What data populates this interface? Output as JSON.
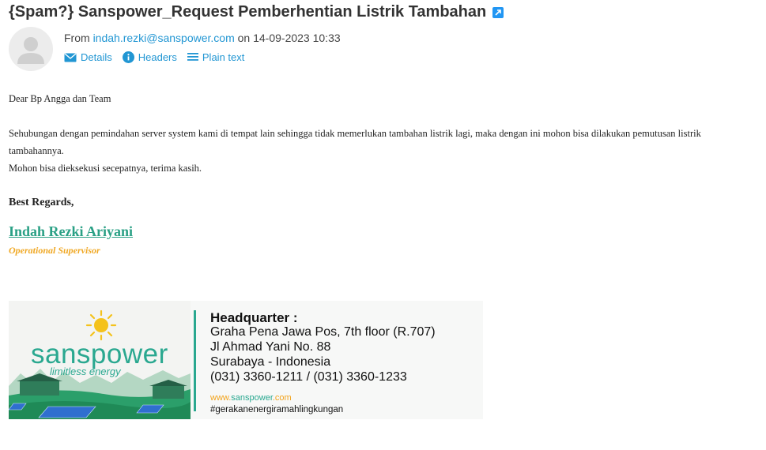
{
  "email": {
    "subject": "{Spam?} Sanspower_Request Pemberhentian Listrik Tambahan",
    "from_prefix": "From ",
    "from_address": "indah.rezki@sanspower.com",
    "date_text": " on 14-09-2023 10:33"
  },
  "actions": {
    "details": "Details",
    "headers": "Headers",
    "plain_text": "Plain text"
  },
  "body": {
    "greeting": "Dear Bp Angga dan Team",
    "paragraph1": "Sehubungan dengan pemindahan server system kami di tempat lain sehingga tidak memerlukan tambahan listrik lagi, maka dengan ini mohon bisa dilakukan pemutusan listrik tambahannya.",
    "paragraph2": "Mohon bisa dieksekusi secepatnya, terima kasih.",
    "closing": "Best Regards,",
    "signature_name": "Indah Rezki Ariyani",
    "signature_title": "Operational Supervisor"
  },
  "banner": {
    "brand": "sanspower",
    "tagline": "limitless energy",
    "hq_title": "Headquarter :",
    "address1": "Graha Pena Jawa Pos, 7th floor (R.707)",
    "address2": "Jl Ahmad Yani No. 88",
    "address3": "Surabaya - Indonesia",
    "phones": "(031) 3360-1211 / (031) 3360-1233",
    "web_prefix": "www.",
    "web_brand": "sanspower",
    "web_suffix": ".com",
    "hashtag": "#gerakanenergiramahlingkungan"
  },
  "colors": {
    "link": "#2196d3",
    "brand_green": "#2aa890",
    "brand_orange": "#f0a824"
  }
}
